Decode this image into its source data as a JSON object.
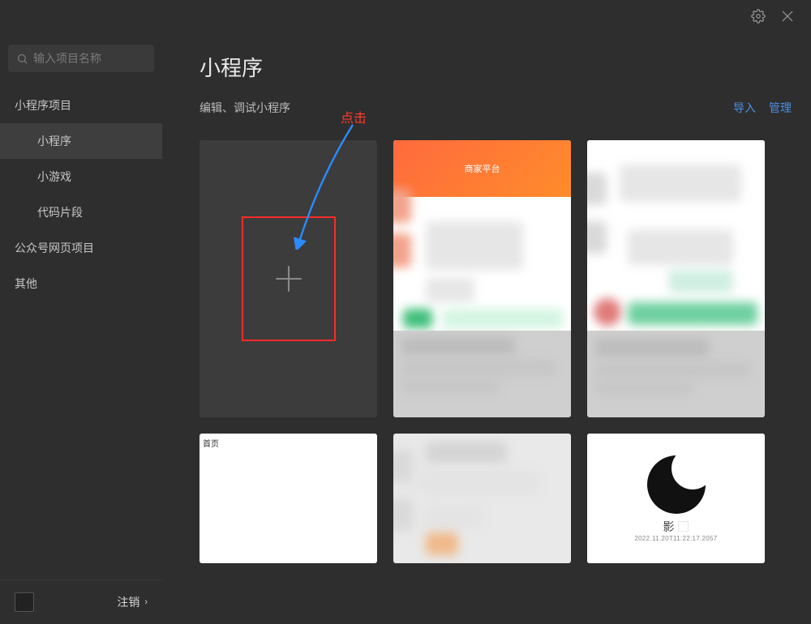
{
  "titlebar": {},
  "sidebar": {
    "search_placeholder": "输入项目名称",
    "group_mp": "小程序项目",
    "item_mp": "小程序",
    "item_game": "小游戏",
    "item_snippet": "代码片段",
    "group_oa": "公众号网页项目",
    "group_other": "其他",
    "logout": "注销"
  },
  "main": {
    "title": "小程序",
    "subtitle": "编辑、调试小程序",
    "import": "导入",
    "manage": "管理"
  },
  "cards": {
    "merchant_banner": "商家平台",
    "home_tag": "首页",
    "ying_label": "影",
    "ying_date": "2022.11.20T11:22:17.2057"
  },
  "annotation": {
    "label": "点击"
  }
}
